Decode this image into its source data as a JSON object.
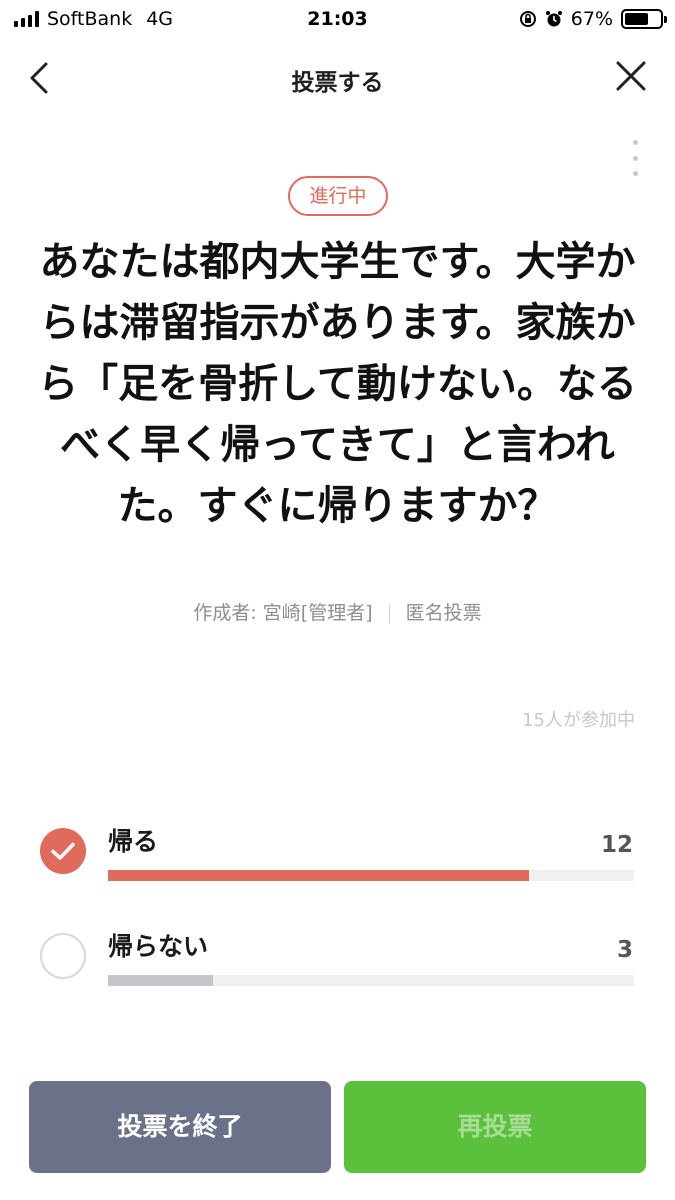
{
  "status_bar": {
    "carrier": "SoftBank",
    "network": "4G",
    "time": "21:03",
    "battery": "67%",
    "battery_level": 0.67
  },
  "header": {
    "title": "投票する"
  },
  "poll": {
    "status": "進行中",
    "question": "あなたは都内大学生です。大学からは滞留指示があります。家族から「足を骨折して動けない。なるべく早く帰ってきて」と言われた。すぐに帰りますか？",
    "author": "作成者: 宮崎[管理者]",
    "type": "匿名投票",
    "participants": "15人が参加中",
    "options": [
      {
        "label": "帰る",
        "count": "12",
        "selected": true,
        "fraction": 0.8
      },
      {
        "label": "帰らない",
        "count": "3",
        "selected": false,
        "fraction": 0.2
      }
    ]
  },
  "buttons": {
    "end": "投票を終了",
    "revote": "再投票"
  },
  "colors": {
    "accent": "#e06a5c",
    "end_button": "#6a7189",
    "revote_button": "#5bc03c"
  }
}
